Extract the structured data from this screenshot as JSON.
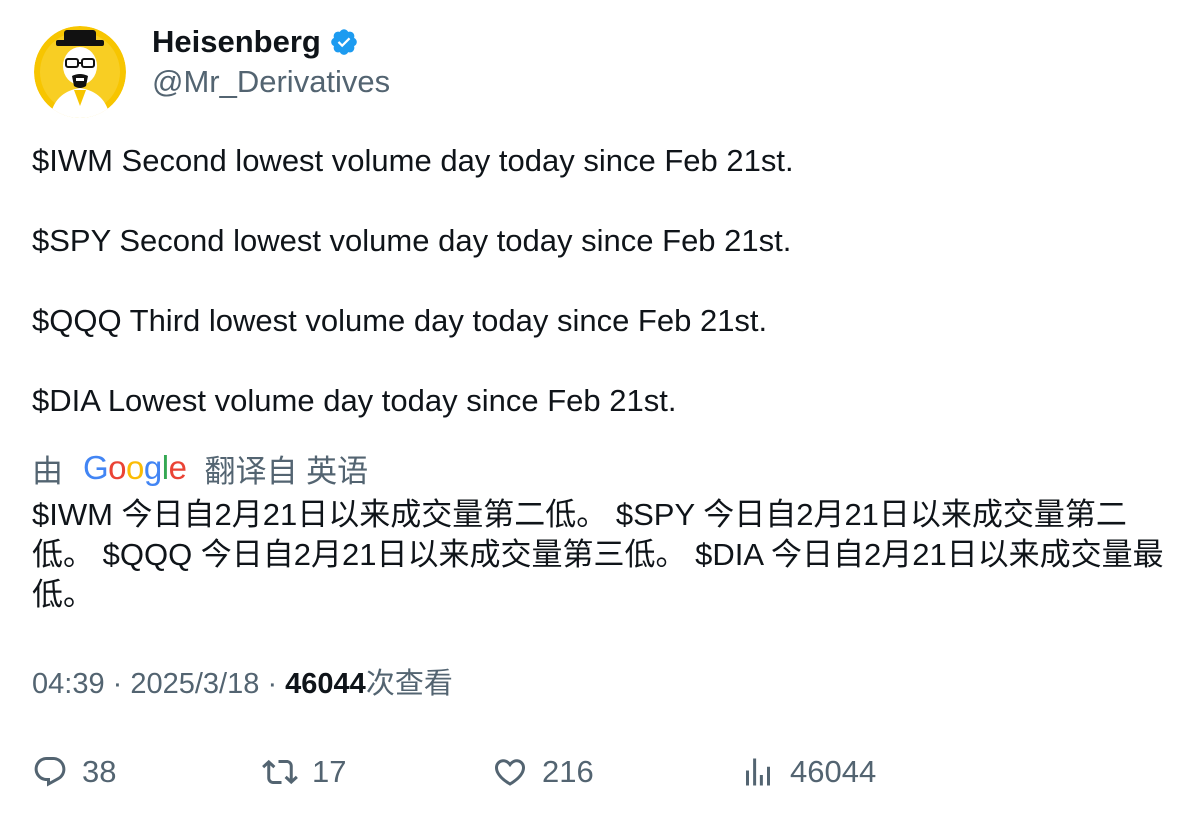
{
  "author": {
    "display_name": "Heisenberg",
    "handle": "@Mr_Derivatives",
    "verified": true,
    "avatar_icon": "heisenberg-avatar-icon"
  },
  "tweet": {
    "lines": [
      "$IWM Second lowest volume day today since Feb 21st.",
      "$SPY Second lowest volume day today since Feb 21st.",
      "$QQQ Third lowest volume day today since Feb 21st.",
      "$DIA Lowest volume day today since Feb 21st."
    ]
  },
  "translation": {
    "by_label": "由",
    "provider": "Google",
    "from_label": "翻译自 英语",
    "text": "$IWM 今日自2月21日以来成交量第二低。 $SPY 今日自2月21日以来成交量第二低。 $QQQ 今日自2月21日以来成交量第三低。 $DIA 今日自2月21日以来成交量最低。"
  },
  "meta": {
    "time": "04:39",
    "separator": "·",
    "date": "2025/3/18",
    "views_count": "46044",
    "views_label": "次查看"
  },
  "actions": {
    "replies": "38",
    "retweets": "17",
    "likes": "216",
    "views": "46044"
  },
  "colors": {
    "text": "#0f1419",
    "muted": "#536471",
    "verified_blue": "#1d9bf0",
    "avatar_yellow": "#f7c500"
  }
}
